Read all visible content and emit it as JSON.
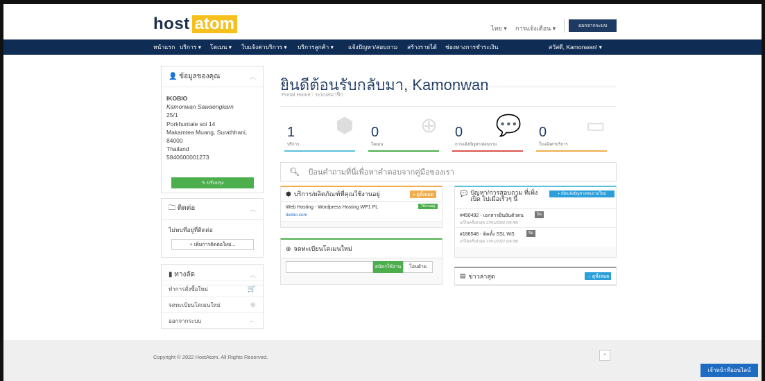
{
  "brand": {
    "logo_part1": "host",
    "logo_part2": "atom",
    "accent": "#f6c11f",
    "navy": "#0f2c55"
  },
  "topbar": {
    "language": "ไทย ▾",
    "notifications": "การแจ้งเตือน ▾",
    "logout": "ออกจากระบบ"
  },
  "nav": {
    "items": [
      "หน้าแรก",
      "บริการ ▾",
      "โดเมน ▾",
      "ใบแจ้งค่าบริการ ▾",
      "บริการลูกค้า ▾",
      "แจ้งปัญหา/สอบถาม",
      "สร้างรายได้",
      "ช่องทางการชำระเงิน"
    ],
    "user": "สวัสดี, Kamonwan! ▾"
  },
  "profile": {
    "header": "ข้อมูลของคุณ",
    "lines": [
      "IKOBIO",
      "Kamonwan Sawaengkarn",
      "25/1",
      "Porkhuntale soi 14",
      "Makamtea Muang, Surathhani,",
      "84000",
      "Thailand",
      "5840600001273"
    ],
    "update_btn": "✎ ปรับปรุง"
  },
  "contacts": {
    "header": "ติดต่อ",
    "empty": "ไม่พบที่อยู่ที่ติดต่อ",
    "add_btn": "+ เพิ่มการติดต่อใหม่..."
  },
  "shortcuts": {
    "header": "ทางลัด",
    "items": [
      "ทำการสั่งซื้อใหม่",
      "จดทะเบียนโดเมนใหม่",
      "ออกจากระบบ"
    ]
  },
  "main": {
    "title": "ยินดีต้อนรับกลับมา, Kamonwan",
    "breadcrumb": [
      "Portal Home",
      "ระบบสมาชิก"
    ]
  },
  "stats": [
    {
      "value": "1",
      "label": "บริการ",
      "color": "#5bc0de"
    },
    {
      "value": "0",
      "label": "โดเมน",
      "color": "#4cae4c"
    },
    {
      "value": "0",
      "label": "การแจ้งปัญหา/สอบถาม",
      "color": "#d9534f"
    },
    {
      "value": "0",
      "label": "ใบแจ้งค่าบริการ",
      "color": "#f0ad4e"
    }
  ],
  "search": {
    "placeholder": "ป้อนคำถามที่นี่เพื่อหาคำตอบจากคู่มือของเรา"
  },
  "services": {
    "header": "บริการ/ผลิตภัณฑ์ที่คุณใช้งานอยู่",
    "view_all": "+ ดูทั้งหมด",
    "item_name": "Web Hosting - Wordpress Hosting WP1 PL",
    "item_domain": "ikobio.com",
    "item_status": "ใช้งานอยู่"
  },
  "domain_reg": {
    "header": "จดทะเบียนโดเมนใหม่",
    "input_value": "",
    "register_btn": "สมัครใช้งาน",
    "transfer_btn": "โอนย้าย"
  },
  "tickets": {
    "header": "ปัญหา/การสอบถาม ที่เพิ่งเปิด ไปเมื่อเร็วๆ นี้",
    "open_btn": "+ เปิดแจ้งปัญหา/สอบถามใหม่",
    "items": [
      {
        "title": "#450492 - เอกสารยืนยันตัวตน",
        "badge": "ปิด",
        "updated": "แก้ไขครั้งล่าสุด 17/01/2022 (08:40)"
      },
      {
        "title": "#186546 - ติดตั้ง SSL WS",
        "badge": "ปิด",
        "updated": "แก้ไขครั้งล่าสุด 17/01/2022 (08:38)"
      }
    ]
  },
  "news": {
    "header": "ข่าวล่าสุด",
    "view_all": "→ ดูทั้งหมด"
  },
  "footer": {
    "copyright": "Copyright © 2022 HostAtom. All Rights Reserved.",
    "back_to_top": "^",
    "chat": "เจ้าหน้าที่ออนไลน์"
  }
}
